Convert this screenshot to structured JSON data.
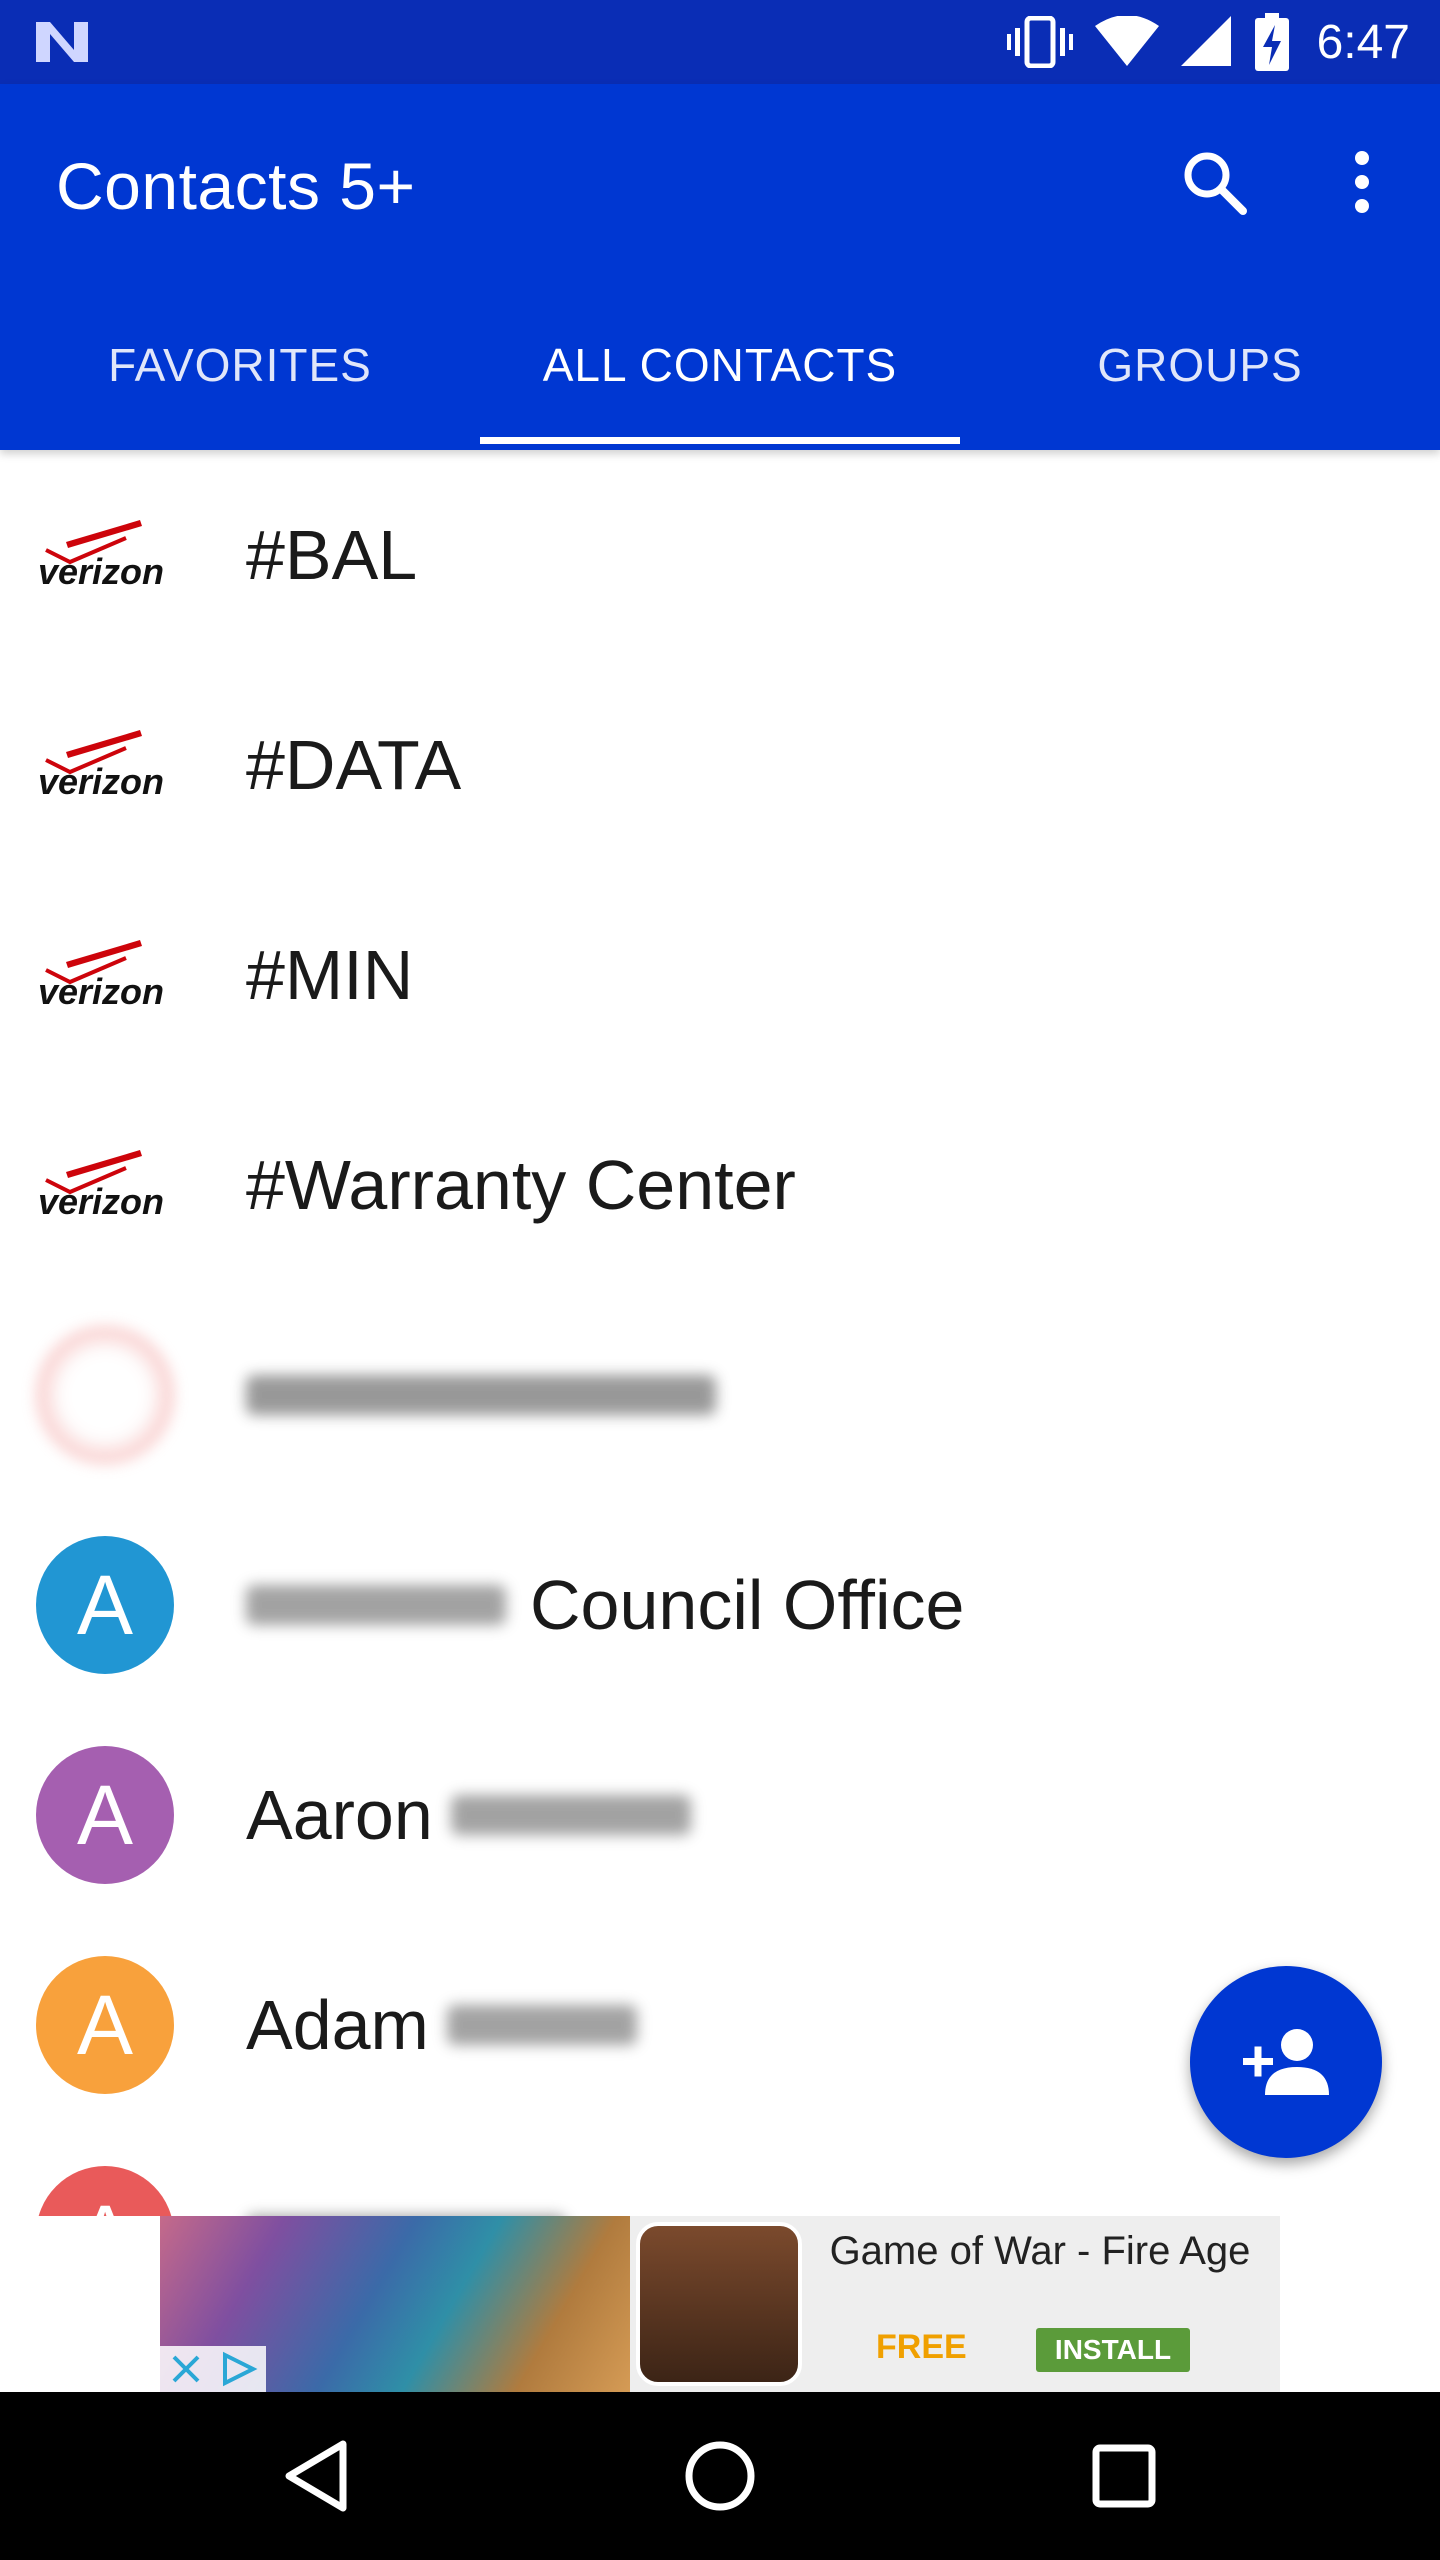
{
  "status_bar": {
    "time": "6:47",
    "icons": [
      "notification-n-icon",
      "vibrate-icon",
      "wifi-icon",
      "signal-icon",
      "battery-charging-icon"
    ]
  },
  "app_bar": {
    "title": "Contacts 5+",
    "search_icon": "search-icon",
    "more_icon": "more-vert-icon"
  },
  "tabs": [
    {
      "label": "FAVORITES",
      "active": false
    },
    {
      "label": "ALL CONTACTS",
      "active": true
    },
    {
      "label": "GROUPS",
      "active": false
    }
  ],
  "contacts": [
    {
      "name": "#BAL",
      "avatar": "verizon-logo"
    },
    {
      "name": "#DATA",
      "avatar": "verizon-logo"
    },
    {
      "name": "#MIN",
      "avatar": "verizon-logo"
    },
    {
      "name": "#Warranty Center",
      "avatar": "verizon-logo"
    },
    {
      "name": "",
      "avatar": "red-logo"
    },
    {
      "name": "Council Office",
      "avatar_letter": "A",
      "avatar_color": "#2196d3"
    },
    {
      "name": "Aaron",
      "avatar_letter": "A",
      "avatar_color": "#a55fb0"
    },
    {
      "name": "Adam",
      "avatar_letter": "A",
      "avatar_color": "#f8a13c"
    },
    {
      "name": "",
      "avatar_letter": "A",
      "avatar_color": "#e95a5a"
    }
  ],
  "fab": {
    "icon": "add-person-icon"
  },
  "ad": {
    "title": "Game of War - Fire Age",
    "price": "FREE",
    "install": "INSTALL"
  },
  "colors": {
    "status_bar": "#0a2db5",
    "primary": "#0037d2",
    "verizon_red": "#cd040b"
  }
}
